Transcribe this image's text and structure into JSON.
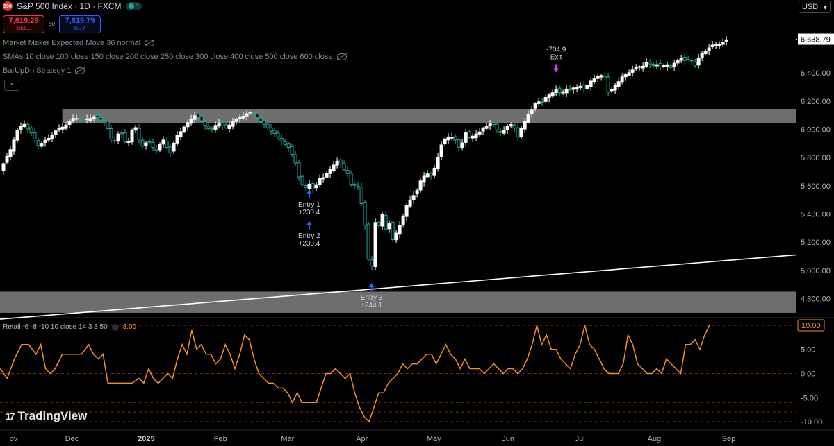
{
  "header": {
    "symbol_title": "S&P 500 Index · 1D · FXCM",
    "logo_text": "500",
    "sell_price": "7,619.29",
    "sell_label": "SELL",
    "spread": "50",
    "buy_price": "7,619.79",
    "buy_label": "BUY",
    "currency": "USD",
    "currency_arrow": "▾"
  },
  "indicators": [
    {
      "label": "Market Maker Expected Move 36 normal"
    },
    {
      "label": "SMAs 10 close 100 close 150 close 200 close 250 close 300 close 400 close 500 close 600 close"
    },
    {
      "label": "BarUpDn Strategy 1"
    }
  ],
  "collapse_icon": "^",
  "retail": {
    "label": "Retail -6 -8 -10 10 close 14 3 3 50",
    "value": "3.00",
    "last_value_label": "10.00"
  },
  "branding": "TradingView",
  "colors": {
    "up": "#ffffff",
    "down": "#26a69a",
    "zone": "#8a8a8a",
    "trendline": "#ffffff",
    "oscillator": "#f7931a",
    "signal_up": "#2962ff",
    "signal_exit": "#e040fb",
    "dashed": "#7a2b2b"
  },
  "chart_data": {
    "type": "candlestick",
    "price_axis": {
      "ticks": [
        4800,
        5000,
        5200,
        5400,
        5600,
        5800,
        6000,
        6200,
        6400
      ],
      "tick_labels": [
        "4,800.00",
        "5,000.00",
        "5,200.00",
        "5,400.00",
        "5,600.00",
        "5,800.00",
        "6,000.00",
        "6,200.00",
        "6,400.00"
      ],
      "last_price": 6638.79,
      "last_price_label": "6,638.79",
      "range": [
        4680,
        6720
      ]
    },
    "time_axis": {
      "labels": [
        "ov",
        "Dec",
        "2025",
        "Feb",
        "Mar",
        "Apr",
        "May",
        "Jun",
        "Jul",
        "Aug",
        "Sep"
      ],
      "bold": [
        false,
        false,
        true,
        false,
        false,
        false,
        false,
        false,
        false,
        false,
        false
      ],
      "positions_days": [
        0,
        26,
        57,
        88,
        116,
        147,
        177,
        208,
        238,
        269,
        300
      ],
      "day_range": [
        -4,
        328
      ]
    },
    "zones": [
      {
        "low": 6045,
        "high": 6145,
        "from_day": 22,
        "to_day": 328
      },
      {
        "low": 4700,
        "high": 4850,
        "from_day": -4,
        "to_day": 328
      }
    ],
    "trendline": {
      "from_day": -4,
      "from_price": 4655,
      "to_day": 328,
      "to_price": 5110
    },
    "close_anchors": [
      [
        -4,
        5705
      ],
      [
        0,
        5840
      ],
      [
        3,
        5990
      ],
      [
        6,
        6040
      ],
      [
        9,
        5970
      ],
      [
        12,
        5890
      ],
      [
        16,
        5930
      ],
      [
        20,
        6000
      ],
      [
        24,
        6040
      ],
      [
        27,
        6080
      ],
      [
        31,
        6070
      ],
      [
        35,
        6090
      ],
      [
        40,
        6050
      ],
      [
        43,
        5900
      ],
      [
        46,
        5990
      ],
      [
        49,
        5880
      ],
      [
        52,
        6040
      ],
      [
        55,
        5880
      ],
      [
        58,
        5910
      ],
      [
        61,
        5850
      ],
      [
        64,
        5930
      ],
      [
        67,
        5830
      ],
      [
        70,
        5960
      ],
      [
        74,
        6040
      ],
      [
        77,
        6100
      ],
      [
        80,
        6060
      ],
      [
        84,
        5990
      ],
      [
        87,
        6050
      ],
      [
        90,
        6000
      ],
      [
        93,
        6060
      ],
      [
        96,
        6080
      ],
      [
        99,
        6110
      ],
      [
        102,
        6120
      ],
      [
        105,
        6050
      ],
      [
        109,
        5990
      ],
      [
        113,
        5930
      ],
      [
        116,
        5880
      ],
      [
        119,
        5780
      ],
      [
        121,
        5640
      ],
      [
        123,
        5580
      ],
      [
        125,
        5620
      ],
      [
        127,
        5560
      ],
      [
        129,
        5650
      ],
      [
        131,
        5660
      ],
      [
        133,
        5700
      ],
      [
        135,
        5750
      ],
      [
        137,
        5780
      ],
      [
        139,
        5720
      ],
      [
        141,
        5690
      ],
      [
        143,
        5580
      ],
      [
        145,
        5630
      ],
      [
        147,
        5460
      ],
      [
        148,
        5400
      ],
      [
        149,
        5060
      ],
      [
        150,
        5080
      ],
      [
        151,
        4960
      ],
      [
        152,
        5450
      ],
      [
        153,
        5270
      ],
      [
        154,
        5310
      ],
      [
        155,
        5420
      ],
      [
        156,
        5380
      ],
      [
        157,
        5290
      ],
      [
        158,
        5360
      ],
      [
        160,
        5200
      ],
      [
        162,
        5300
      ],
      [
        164,
        5370
      ],
      [
        166,
        5480
      ],
      [
        168,
        5520
      ],
      [
        170,
        5560
      ],
      [
        172,
        5660
      ],
      [
        174,
        5690
      ],
      [
        176,
        5670
      ],
      [
        178,
        5760
      ],
      [
        180,
        5880
      ],
      [
        182,
        5940
      ],
      [
        184,
        5960
      ],
      [
        186,
        5920
      ],
      [
        188,
        5850
      ],
      [
        190,
        5980
      ],
      [
        192,
        5930
      ],
      [
        194,
        5970
      ],
      [
        196,
        5980
      ],
      [
        198,
        6010
      ],
      [
        200,
        6040
      ],
      [
        202,
        6030
      ],
      [
        204,
        5980
      ],
      [
        206,
        5990
      ],
      [
        208,
        6020
      ],
      [
        210,
        6040
      ],
      [
        212,
        5940
      ],
      [
        214,
        6030
      ],
      [
        216,
        6100
      ],
      [
        218,
        6140
      ],
      [
        220,
        6200
      ],
      [
        222,
        6190
      ],
      [
        224,
        6230
      ],
      [
        226,
        6260
      ],
      [
        228,
        6280
      ],
      [
        230,
        6240
      ],
      [
        232,
        6290
      ],
      [
        234,
        6280
      ],
      [
        236,
        6300
      ],
      [
        238,
        6310
      ],
      [
        240,
        6270
      ],
      [
        242,
        6340
      ],
      [
        244,
        6360
      ],
      [
        246,
        6380
      ],
      [
        248,
        6390
      ],
      [
        250,
        6240
      ],
      [
        252,
        6300
      ],
      [
        254,
        6340
      ],
      [
        256,
        6380
      ],
      [
        258,
        6400
      ],
      [
        260,
        6420
      ],
      [
        262,
        6440
      ],
      [
        264,
        6450
      ],
      [
        266,
        6480
      ],
      [
        268,
        6450
      ],
      [
        270,
        6460
      ],
      [
        272,
        6430
      ],
      [
        274,
        6470
      ],
      [
        276,
        6440
      ],
      [
        278,
        6480
      ],
      [
        280,
        6510
      ],
      [
        282,
        6480
      ],
      [
        284,
        6500
      ],
      [
        286,
        6460
      ],
      [
        288,
        6520
      ],
      [
        290,
        6550
      ],
      [
        292,
        6580
      ],
      [
        294,
        6600
      ],
      [
        296,
        6610
      ],
      [
        298,
        6620
      ],
      [
        300,
        6639
      ]
    ],
    "signals": [
      {
        "type": "entry",
        "day": 125,
        "label_line1": "Entry 1",
        "label_line2": "+230.4"
      },
      {
        "type": "entry",
        "day": 125,
        "label_line1": "Entry 2",
        "label_line2": "+230.4"
      },
      {
        "type": "entry",
        "day": 151,
        "label_line1": "Entry 3",
        "label_line2": "+244.1"
      },
      {
        "type": "exit",
        "day": 228,
        "label_line1": "-704.9",
        "label_line2": "Exit"
      }
    ],
    "oscillator": {
      "name": "Retail",
      "ticks": [
        -10,
        -5,
        0,
        5,
        10
      ],
      "tick_labels": [
        "-10.00",
        "-5.00",
        "0.00",
        "5.00",
        "10.00"
      ],
      "dashed_levels": [
        -10,
        -8,
        -6,
        0,
        10
      ],
      "range": [
        -11,
        11
      ],
      "points": [
        [
          -4,
          1
        ],
        [
          -1,
          -1
        ],
        [
          2,
          3
        ],
        [
          5,
          6
        ],
        [
          8,
          6
        ],
        [
          11,
          4
        ],
        [
          13,
          6
        ],
        [
          15,
          1
        ],
        [
          17,
          0
        ],
        [
          19,
          1
        ],
        [
          22,
          4
        ],
        [
          24,
          4
        ],
        [
          27,
          4
        ],
        [
          30,
          4
        ],
        [
          33,
          6
        ],
        [
          35,
          4
        ],
        [
          37,
          3
        ],
        [
          39,
          4
        ],
        [
          41,
          -2
        ],
        [
          43,
          -2
        ],
        [
          45,
          -2
        ],
        [
          48,
          -2
        ],
        [
          51,
          -2
        ],
        [
          54,
          -1
        ],
        [
          56,
          -2
        ],
        [
          58,
          1
        ],
        [
          60,
          -1
        ],
        [
          62,
          -2
        ],
        [
          64,
          -1
        ],
        [
          66,
          0
        ],
        [
          68,
          -1
        ],
        [
          70,
          3
        ],
        [
          72,
          6
        ],
        [
          74,
          4
        ],
        [
          76,
          9
        ],
        [
          78,
          5
        ],
        [
          80,
          6
        ],
        [
          82,
          4
        ],
        [
          84,
          4
        ],
        [
          86,
          2
        ],
        [
          88,
          3
        ],
        [
          90,
          6
        ],
        [
          92,
          4
        ],
        [
          94,
          1
        ],
        [
          96,
          4
        ],
        [
          98,
          8
        ],
        [
          100,
          7
        ],
        [
          102,
          3
        ],
        [
          104,
          0
        ],
        [
          106,
          -1
        ],
        [
          108,
          -2
        ],
        [
          110,
          -2
        ],
        [
          112,
          -3
        ],
        [
          114,
          -3
        ],
        [
          116,
          -4
        ],
        [
          118,
          -6
        ],
        [
          120,
          -4
        ],
        [
          122,
          -6
        ],
        [
          124,
          -6
        ],
        [
          126,
          -6
        ],
        [
          128,
          -6
        ],
        [
          130,
          -3
        ],
        [
          132,
          0
        ],
        [
          134,
          0
        ],
        [
          136,
          1
        ],
        [
          138,
          0
        ],
        [
          140,
          -1
        ],
        [
          142,
          0
        ],
        [
          144,
          -4
        ],
        [
          146,
          -7
        ],
        [
          148,
          -9
        ],
        [
          150,
          -10
        ],
        [
          152,
          -7
        ],
        [
          154,
          -4
        ],
        [
          156,
          -4
        ],
        [
          158,
          -2
        ],
        [
          160,
          -1
        ],
        [
          162,
          0
        ],
        [
          164,
          2
        ],
        [
          166,
          1
        ],
        [
          168,
          2
        ],
        [
          170,
          2
        ],
        [
          172,
          3
        ],
        [
          174,
          4
        ],
        [
          176,
          4
        ],
        [
          178,
          2
        ],
        [
          180,
          4
        ],
        [
          182,
          6
        ],
        [
          184,
          4
        ],
        [
          186,
          3
        ],
        [
          188,
          1
        ],
        [
          190,
          3
        ],
        [
          192,
          1
        ],
        [
          194,
          1
        ],
        [
          196,
          1
        ],
        [
          198,
          0
        ],
        [
          200,
          1
        ],
        [
          202,
          2
        ],
        [
          204,
          1
        ],
        [
          206,
          0
        ],
        [
          208,
          1
        ],
        [
          210,
          1
        ],
        [
          212,
          0
        ],
        [
          214,
          1
        ],
        [
          216,
          3
        ],
        [
          218,
          6
        ],
        [
          220,
          10
        ],
        [
          222,
          6
        ],
        [
          224,
          8
        ],
        [
          226,
          5
        ],
        [
          228,
          5
        ],
        [
          230,
          3
        ],
        [
          232,
          2
        ],
        [
          234,
          1
        ],
        [
          236,
          4
        ],
        [
          238,
          6
        ],
        [
          240,
          10
        ],
        [
          242,
          6
        ],
        [
          244,
          5
        ],
        [
          246,
          3
        ],
        [
          248,
          1
        ],
        [
          250,
          0
        ],
        [
          252,
          0
        ],
        [
          254,
          0
        ],
        [
          256,
          2
        ],
        [
          258,
          8
        ],
        [
          260,
          6
        ],
        [
          262,
          2
        ],
        [
          264,
          1
        ],
        [
          266,
          0
        ],
        [
          268,
          0
        ],
        [
          270,
          1
        ],
        [
          272,
          0
        ],
        [
          274,
          3
        ],
        [
          276,
          2
        ],
        [
          278,
          1
        ],
        [
          280,
          0
        ],
        [
          282,
          6
        ],
        [
          284,
          6
        ],
        [
          286,
          7
        ],
        [
          288,
          5
        ],
        [
          290,
          8
        ],
        [
          292,
          10
        ]
      ]
    }
  }
}
